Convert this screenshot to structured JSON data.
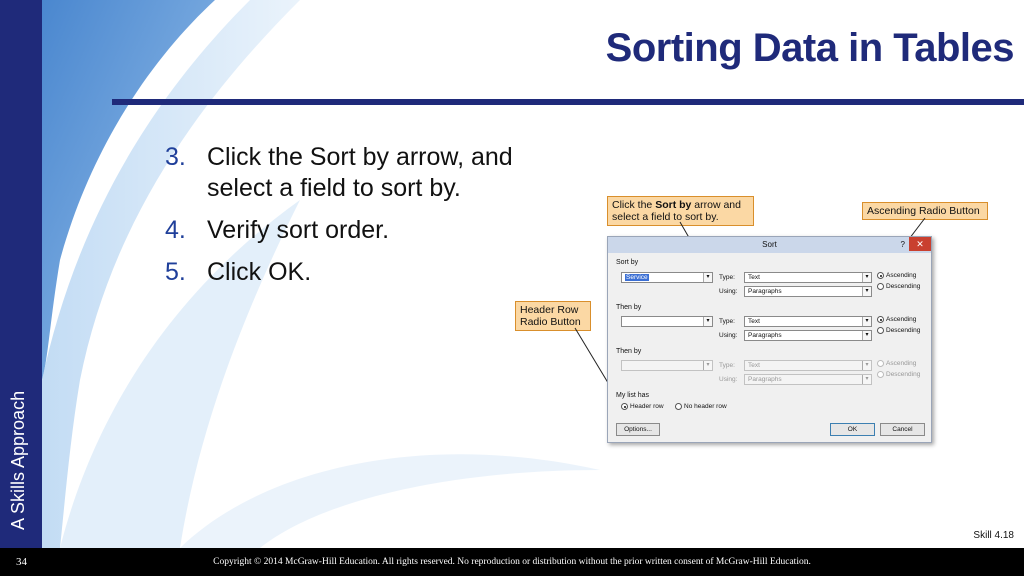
{
  "slide": {
    "title": "Sorting Data in Tables",
    "side_label": "A Skills Approach",
    "skill": "Skill 4.18",
    "page_number": "34",
    "copyright": "Copyright © 2014 McGraw-Hill Education. All rights reserved. No reproduction or distribution without the prior written consent of McGraw-Hill Education.",
    "colors": {
      "navy": "#1f2a7a",
      "callout_fill": "#fbd8a4",
      "callout_border": "#d98f2c"
    }
  },
  "steps": [
    {
      "num": "3.",
      "text": "Click the Sort by arrow, and select a field to sort by."
    },
    {
      "num": "4.",
      "text": "Verify sort order."
    },
    {
      "num": "5.",
      "text": "Click OK."
    }
  ],
  "callouts": {
    "sort_by": "Click the Sort by arrow and select a field to sort by.",
    "sort_by_pre": "Click the ",
    "sort_by_bold": "Sort by",
    "sort_by_post": " arrow and select a field to sort by.",
    "ascending": "Ascending Radio Button",
    "header_row_line1": "Header Row",
    "header_row_line2": "Radio Button"
  },
  "dialog": {
    "title": "Sort",
    "help": "?",
    "close": "✕",
    "sort_by": {
      "label": "Sort by",
      "field": "Service",
      "type_label": "Type:",
      "type_value": "Text",
      "using_label": "Using:",
      "using_value": "Paragraphs",
      "ascending": "Ascending",
      "descending": "Descending"
    },
    "then_by_1": {
      "label": "Then by",
      "field": "",
      "type_label": "Type:",
      "type_value": "Text",
      "using_label": "Using:",
      "using_value": "Paragraphs",
      "ascending": "Ascending",
      "descending": "Descending"
    },
    "then_by_2": {
      "label": "Then by",
      "field": "",
      "type_label": "Type:",
      "type_value": "Text",
      "using_label": "Using:",
      "using_value": "Paragraphs",
      "ascending": "Ascending",
      "descending": "Descending"
    },
    "list_has": {
      "label": "My list has",
      "header_row": "Header row",
      "no_header_row": "No header row"
    },
    "buttons": {
      "options": "Options...",
      "ok": "OK",
      "cancel": "Cancel"
    }
  }
}
